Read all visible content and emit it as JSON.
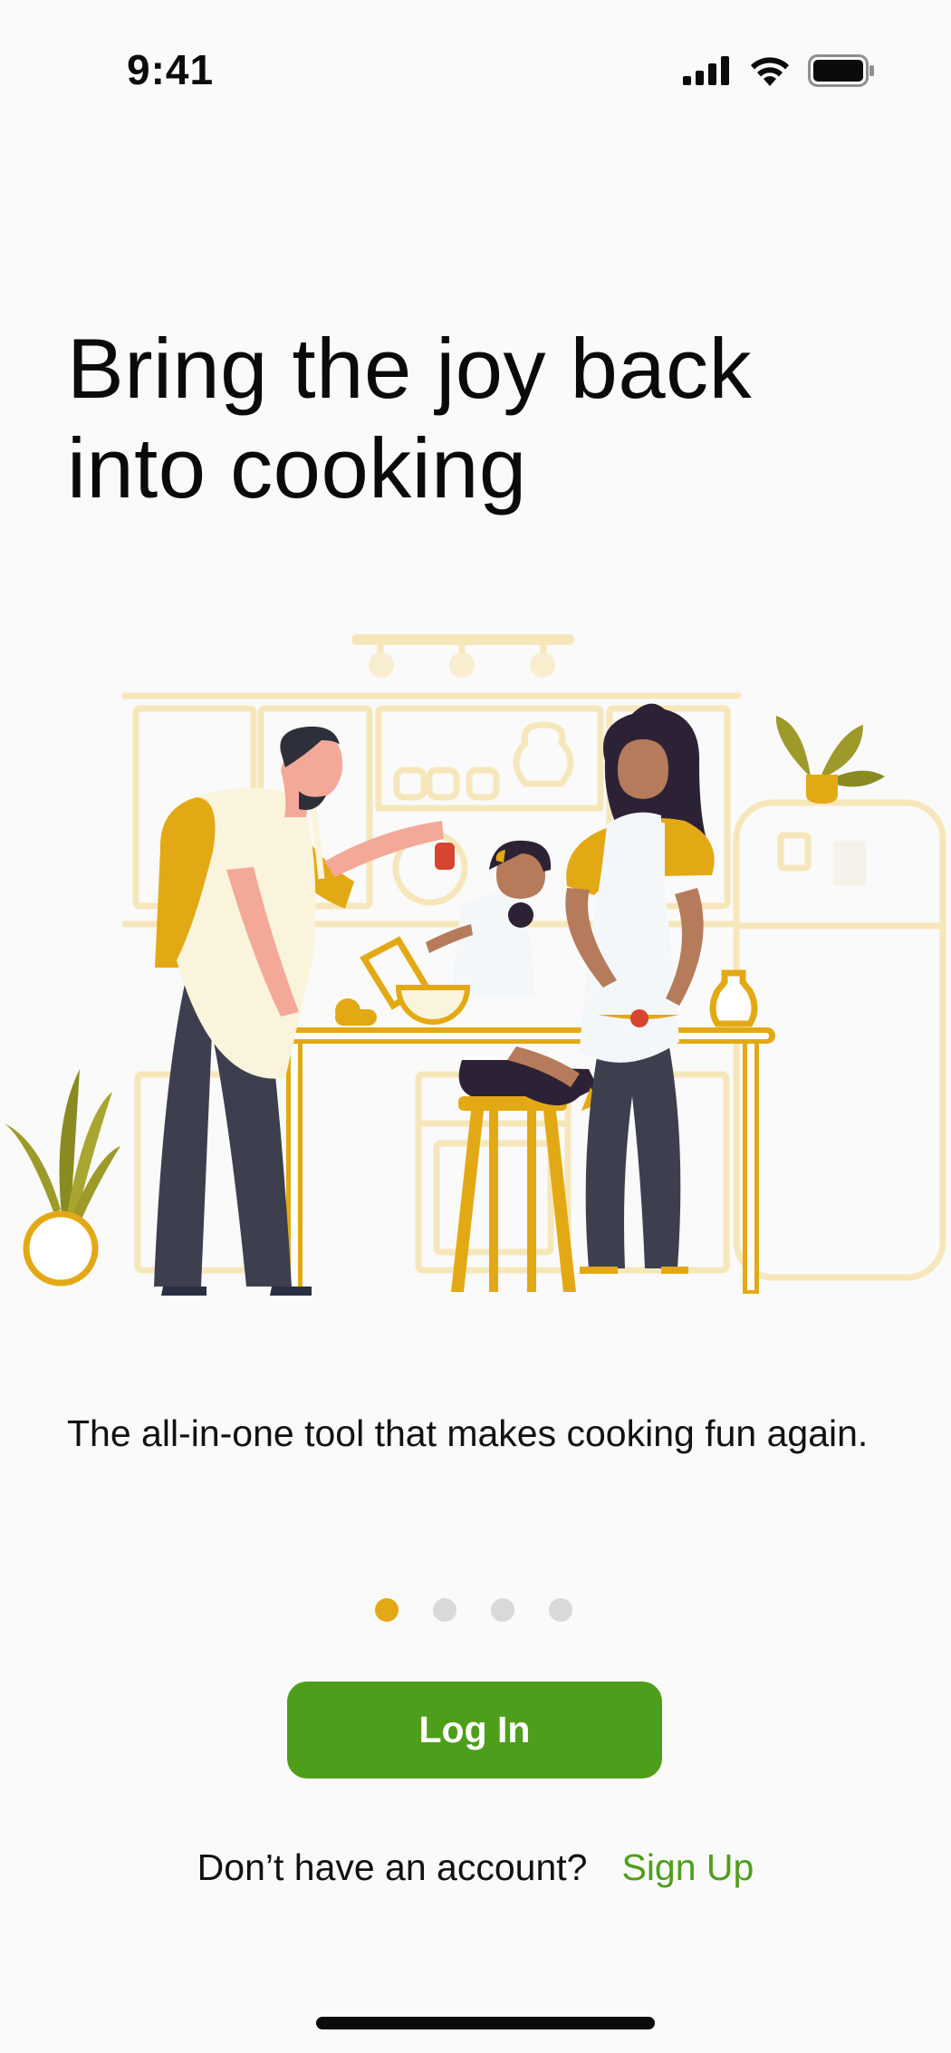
{
  "status_bar": {
    "time": "9:41"
  },
  "onboarding": {
    "headline_line1": "Bring the joy back",
    "headline_line2": "into cooking",
    "tagline": "The all-in-one tool that makes cooking fun again.",
    "page_count": 4,
    "active_page": 1
  },
  "actions": {
    "login_label": "Log In",
    "signup_prompt": "Don’t have an account?",
    "signup_label": "Sign Up"
  },
  "colors": {
    "accent_yellow": "#e3a915",
    "primary_green": "#4e9e1b",
    "background": "#fafafa"
  },
  "icons": [
    "cellular-signal-icon",
    "wifi-icon",
    "battery-icon"
  ]
}
